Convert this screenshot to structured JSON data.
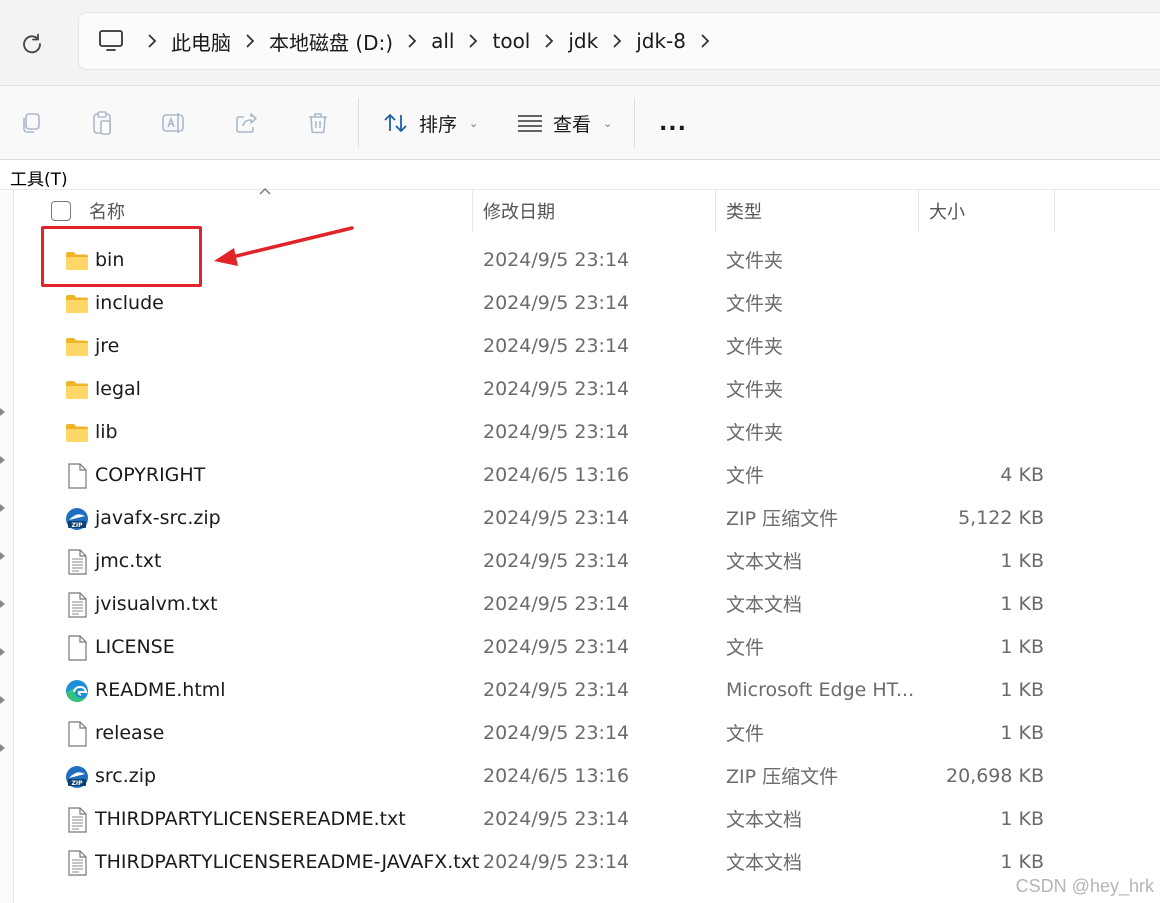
{
  "address": {
    "breadcrumbs": [
      "此电脑",
      "本地磁盘 (D:)",
      "all",
      "tool",
      "jdk",
      "jdk-8"
    ]
  },
  "toolbar": {
    "sort_label": "排序",
    "view_label": "查看",
    "more_label": "..."
  },
  "menu": {
    "tools_label": "工具(T)"
  },
  "columns": {
    "name": "名称",
    "modified": "修改日期",
    "type": "类型",
    "size": "大小"
  },
  "files": [
    {
      "name": "bin",
      "modified": "2024/9/5 23:14",
      "type": "文件夹",
      "size": "",
      "icon": "folder-icon"
    },
    {
      "name": "include",
      "modified": "2024/9/5 23:14",
      "type": "文件夹",
      "size": "",
      "icon": "folder-icon"
    },
    {
      "name": "jre",
      "modified": "2024/9/5 23:14",
      "type": "文件夹",
      "size": "",
      "icon": "folder-icon"
    },
    {
      "name": "legal",
      "modified": "2024/9/5 23:14",
      "type": "文件夹",
      "size": "",
      "icon": "folder-icon"
    },
    {
      "name": "lib",
      "modified": "2024/9/5 23:14",
      "type": "文件夹",
      "size": "",
      "icon": "folder-icon"
    },
    {
      "name": "COPYRIGHT",
      "modified": "2024/6/5 13:16",
      "type": "文件",
      "size": "4 KB",
      "icon": "file-icon"
    },
    {
      "name": "javafx-src.zip",
      "modified": "2024/9/5 23:14",
      "type": "ZIP 压缩文件",
      "size": "5,122 KB",
      "icon": "zip-icon"
    },
    {
      "name": "jmc.txt",
      "modified": "2024/9/5 23:14",
      "type": "文本文档",
      "size": "1 KB",
      "icon": "text-file-icon"
    },
    {
      "name": "jvisualvm.txt",
      "modified": "2024/9/5 23:14",
      "type": "文本文档",
      "size": "1 KB",
      "icon": "text-file-icon"
    },
    {
      "name": "LICENSE",
      "modified": "2024/9/5 23:14",
      "type": "文件",
      "size": "1 KB",
      "icon": "file-icon"
    },
    {
      "name": "README.html",
      "modified": "2024/9/5 23:14",
      "type": "Microsoft Edge HT...",
      "size": "1 KB",
      "icon": "edge-icon"
    },
    {
      "name": "release",
      "modified": "2024/9/5 23:14",
      "type": "文件",
      "size": "1 KB",
      "icon": "file-icon"
    },
    {
      "name": "src.zip",
      "modified": "2024/6/5 13:16",
      "type": "ZIP 压缩文件",
      "size": "20,698 KB",
      "icon": "zip-icon"
    },
    {
      "name": "THIRDPARTYLICENSEREADME.txt",
      "modified": "2024/9/5 23:14",
      "type": "文本文档",
      "size": "1 KB",
      "icon": "text-file-icon"
    },
    {
      "name": "THIRDPARTYLICENSEREADME-JAVAFX.txt",
      "modified": "2024/9/5 23:14",
      "type": "文本文档",
      "size": "1 KB",
      "icon": "text-file-icon"
    }
  ],
  "annotation": {
    "color": "#e0242a"
  },
  "watermark": "CSDN @hey_hrk"
}
